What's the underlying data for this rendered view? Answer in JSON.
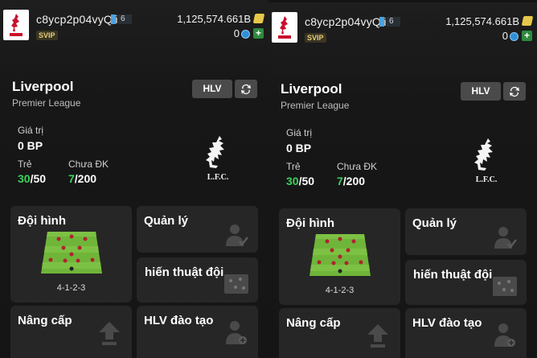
{
  "panels": [
    {
      "user": {
        "name": "c8ycp2p04vyQli",
        "level": "6",
        "badge": "SVIP"
      },
      "currency": {
        "bp": "1,125,574.661B",
        "coins": "0"
      },
      "club": {
        "name": "Liverpool",
        "league": "Premier League"
      },
      "buttons": {
        "hlv": "HLV"
      },
      "stats": {
        "value_label": "Giá trị",
        "value": "0 BP",
        "tre_label": "Trẻ",
        "tre_current": "30",
        "tre_max": "/50",
        "dk_label": "Chưa ĐK",
        "dk_current": "7",
        "dk_max": "/200"
      },
      "cards": {
        "squad": "Đội hình",
        "formation": "4-1-2-3",
        "manage": "Quản lý",
        "tactics": "hiến thuật đội",
        "upgrade": "Nâng cấp",
        "coach": "HLV đào tạo"
      }
    },
    {
      "user": {
        "name": "c8ycp2p04vyQli",
        "level": "6",
        "badge": "SVIP"
      },
      "currency": {
        "bp": "1,125,574.661B",
        "coins": "0"
      },
      "club": {
        "name": "Liverpool",
        "league": "Premier League"
      },
      "buttons": {
        "hlv": "HLV"
      },
      "stats": {
        "value_label": "Giá trị",
        "value": "0 BP",
        "tre_label": "Trẻ",
        "tre_current": "30",
        "tre_max": "/50",
        "dk_label": "Chưa ĐK",
        "dk_current": "7",
        "dk_max": "/200"
      },
      "cards": {
        "squad": "Đội hình",
        "formation": "4-1-2-3",
        "manage": "Quản lý",
        "tactics": "hiến thuật đội",
        "upgrade": "Nâng cấp",
        "coach": "HLV đào tạo"
      }
    }
  ],
  "colors": {
    "accent_green": "#3ad35a",
    "card_bg": "#262626",
    "svip": "#e5cf7a"
  },
  "icons": [
    "lfc-logo-icon",
    "money-icon",
    "coin-icon",
    "plus-icon",
    "swap-icon",
    "lfc-crest-icon",
    "manager-icon",
    "tactics-board-icon",
    "upgrade-arrow-icon",
    "coach-icon"
  ]
}
